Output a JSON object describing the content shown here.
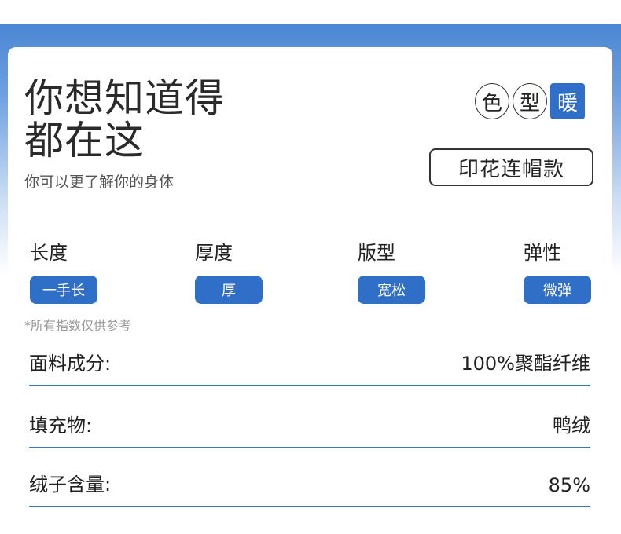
{
  "header": {
    "title_line1": "你想知道得",
    "title_line2": "都在这",
    "subtitle": "你可以更了解你的身体"
  },
  "badges": [
    "色",
    "型",
    "暖"
  ],
  "style_name": "印花连帽款",
  "attributes": [
    {
      "label": "长度",
      "value": "一手长"
    },
    {
      "label": "厚度",
      "value": "厚"
    },
    {
      "label": "版型",
      "value": "宽松"
    },
    {
      "label": "弹性",
      "value": "微弹"
    }
  ],
  "note": "*所有指数仅供参考",
  "specs": [
    {
      "label": "面料成分:",
      "value": "100%聚酯纤维"
    },
    {
      "label": "填充物:",
      "value": "鸭绒"
    },
    {
      "label": "绒子含量:",
      "value": "85%"
    }
  ],
  "colors": {
    "accent": "#2f6fc8",
    "band_top": "#4b86d3"
  }
}
